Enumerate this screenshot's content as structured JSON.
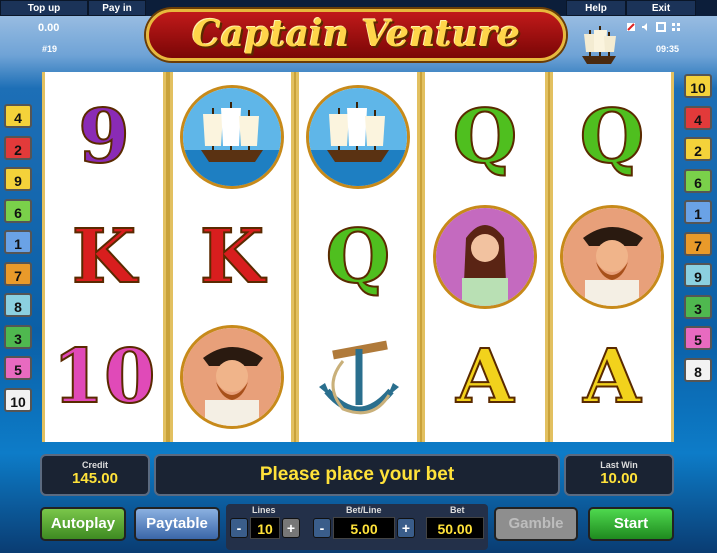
{
  "header": {
    "top_up_label": "Top up",
    "pay_in_label": "Pay in",
    "help_label": "Help",
    "exit_label": "Exit",
    "balance": "0.00",
    "game_number": "#19",
    "clock": "09:35"
  },
  "logo_text": "Captain Venture",
  "lines_left": [
    "4",
    "2",
    "9",
    "6",
    "1",
    "7",
    "8",
    "3",
    "5",
    "10"
  ],
  "lines_right": [
    "10",
    "4",
    "2",
    "6",
    "1",
    "7",
    "9",
    "3",
    "5",
    "8"
  ],
  "reels": [
    [
      "9",
      "K",
      "10"
    ],
    [
      "ship",
      "K",
      "captain"
    ],
    [
      "ship",
      "Q",
      "anchor"
    ],
    [
      "Q",
      "lady",
      "A"
    ],
    [
      "Q",
      "captain",
      "A"
    ]
  ],
  "credit": {
    "label": "Credit",
    "value": "145.00"
  },
  "message": "Please place your bet",
  "last_win": {
    "label": "Last Win",
    "value": "10.00"
  },
  "controls": {
    "autoplay_label": "Autoplay",
    "paytable_label": "Paytable",
    "lines_label": "Lines",
    "lines_value": "10",
    "bet_line_label": "Bet/Line",
    "bet_line_value": "5.00",
    "bet_label": "Bet",
    "bet_value": "50.00",
    "minus_glyph": "-",
    "plus_glyph": "+",
    "gamble_label": "Gamble",
    "start_label": "Start"
  },
  "colors": {
    "letter_9": "#8a2bb5",
    "letter_K": "#d81e1e",
    "letter_10": "#e04ab8",
    "letter_Q": "#4fbf1f",
    "letter_A": "#f2d21c",
    "start_green": "#2fb52f",
    "text_yellow": "#ffe23a"
  }
}
